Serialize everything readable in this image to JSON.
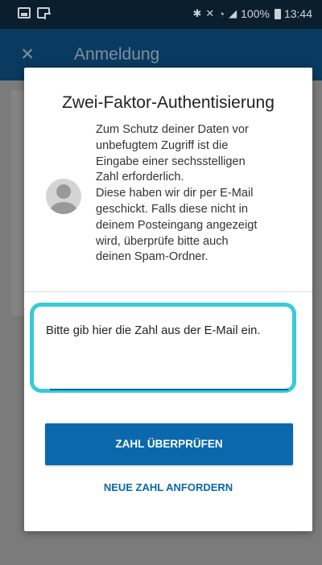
{
  "status_bar": {
    "icons": [
      "image-icon",
      "document-icon",
      "bluetooth-icon",
      "mute-icon",
      "wifi-icon",
      "signal-icon",
      "battery-icon"
    ],
    "battery": "100%",
    "time": "13:44"
  },
  "app_bar": {
    "title": "Anmeldung"
  },
  "dialog": {
    "title": "Zwei-Faktor-Authentisierung",
    "description": "Zum Schutz deiner Daten vor\nunbefugtem Zugriff ist die\nEingabe einer sechsstelligen\nZahl erforderlich.\nDiese haben wir dir per E-Mail\ngeschickt. Falls diese nicht in\ndeinem Posteingang angezeigt\nwird, überprüfe bitte auch\ndeinen Spam-Ordner.",
    "input_label": "Bitte gib hier die Zahl aus der E-Mail ein.",
    "input_value": "",
    "verify_button": "ZAHL ÜBERPRÜFEN",
    "request_link": "NEUE ZAHL ANFORDERN"
  },
  "colors": {
    "status_bar": "#0a1e2d",
    "app_bar": "#0a3a5f",
    "primary": "#0b68ad",
    "highlight": "#36cbd7",
    "backdrop": "#7b7b7b"
  }
}
